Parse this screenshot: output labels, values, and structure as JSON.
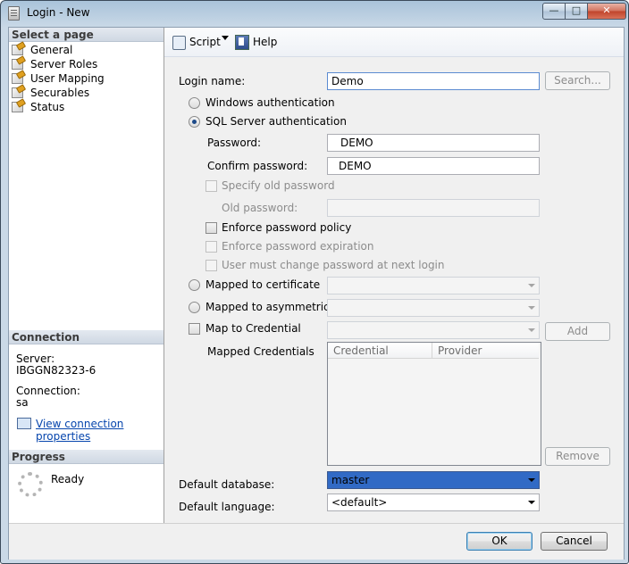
{
  "window": {
    "title": "Login - New"
  },
  "sidebar": {
    "heading": "Select a page",
    "pages": [
      {
        "label": "General"
      },
      {
        "label": "Server Roles"
      },
      {
        "label": "User Mapping"
      },
      {
        "label": "Securables"
      },
      {
        "label": "Status"
      }
    ]
  },
  "connection": {
    "heading": "Connection",
    "server_label": "Server:",
    "server_value": "IBGGN82323-6",
    "connection_label": "Connection:",
    "connection_value": "sa",
    "view_link": "View connection properties"
  },
  "progress": {
    "heading": "Progress",
    "status": "Ready"
  },
  "toolbar": {
    "script_label": "Script",
    "help_label": "Help"
  },
  "form": {
    "login_name_label": "Login name:",
    "login_name_value": "Demo",
    "search_button": "Search...",
    "windows_auth": "Windows authentication",
    "sql_auth": "SQL Server authentication",
    "password_label": "Password:",
    "password_value": "DEMO",
    "confirm_label": "Confirm password:",
    "confirm_value": "DEMO",
    "specify_old": "Specify old password",
    "old_password_label": "Old password:",
    "enforce_policy": "Enforce password policy",
    "enforce_expiration": "Enforce password expiration",
    "must_change": "User must change password at next login",
    "mapped_cert": "Mapped to certificate",
    "mapped_asym": "Mapped to asymmetric key",
    "map_credential": "Map to Credential",
    "add_button": "Add",
    "mapped_credentials_label": "Mapped Credentials",
    "credential_col": "Credential",
    "provider_col": "Provider",
    "remove_button": "Remove",
    "default_db_label": "Default database:",
    "default_db_value": "master",
    "default_lang_label": "Default language:",
    "default_lang_value": "<default>"
  },
  "footer": {
    "ok": "OK",
    "cancel": "Cancel"
  }
}
